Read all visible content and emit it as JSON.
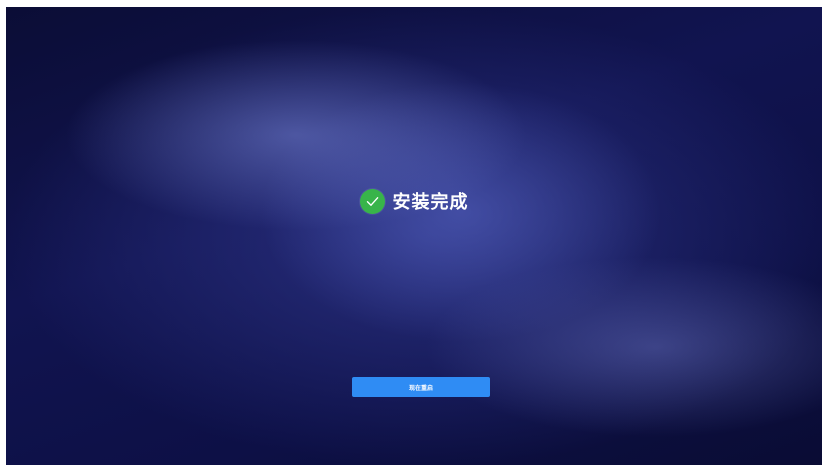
{
  "status": {
    "icon": "check-circle-icon",
    "title": "安装完成",
    "icon_color": "#38b44a"
  },
  "actions": {
    "restart_label": "现在重启",
    "button_color": "#2f8cf4"
  },
  "background": {
    "base_color": "#0d1046",
    "glow_color": "#5a69c8"
  }
}
